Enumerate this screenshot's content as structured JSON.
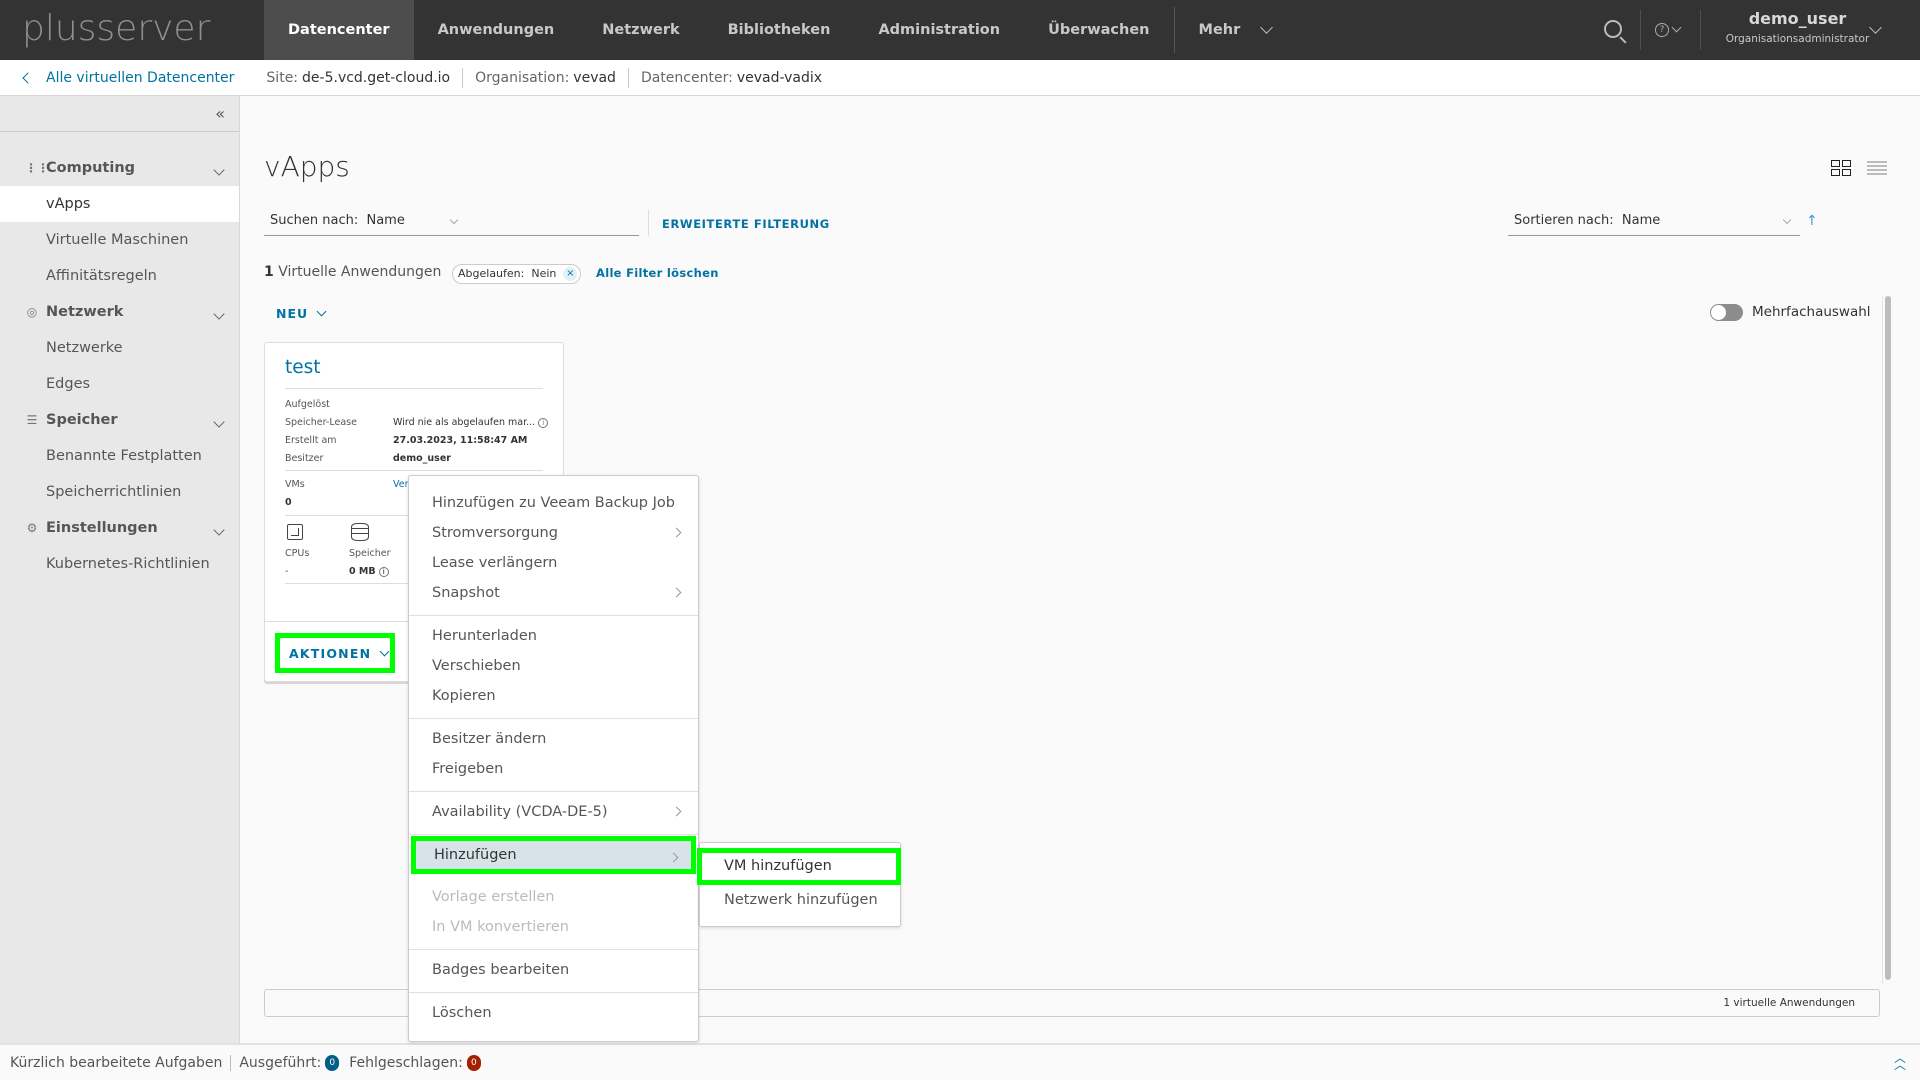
{
  "header": {
    "logo": "plusserver",
    "nav": [
      {
        "label": "Datencenter",
        "active": true
      },
      {
        "label": "Anwendungen"
      },
      {
        "label": "Netzwerk"
      },
      {
        "label": "Bibliotheken"
      },
      {
        "label": "Administration"
      },
      {
        "label": "Überwachen"
      }
    ],
    "more_label": "Mehr",
    "help_icon": "?",
    "user_name": "demo_user",
    "user_role": "Organisationsadministrator"
  },
  "breadcrumb": {
    "back_label": "Alle virtuellen Datencenter",
    "site_label": "Site:",
    "site_value": "de-5.vcd.get-cloud.io",
    "org_label": "Organisation:",
    "org_value": "vevad",
    "dc_label": "Datencenter:",
    "dc_value": "vevad-vadix"
  },
  "sidebar": {
    "collapse_icon": "«",
    "groups": [
      {
        "label": "Computing",
        "icon": "⋮⋮",
        "items": [
          "vApps",
          "Virtuelle Maschinen",
          "Affinitätsregeln"
        ]
      },
      {
        "label": "Netzwerk",
        "icon": "◎",
        "items": [
          "Netzwerke",
          "Edges"
        ]
      },
      {
        "label": "Speicher",
        "icon": "☰",
        "items": [
          "Benannte Festplatten",
          "Speicherrichtlinien"
        ]
      },
      {
        "label": "Einstellungen",
        "icon": "⚙",
        "items": [
          "Kubernetes-Richtlinien"
        ]
      }
    ],
    "active_item": "vApps"
  },
  "main": {
    "title": "vApps",
    "search_label": "Suchen nach:  Name",
    "advanced_filter": "ERWEITERTE FILTERUNG",
    "sort_label": "Sortieren nach:  Name",
    "sort_arrow": "↑",
    "count_number": "1",
    "count_label": " Virtuelle Anwendungen",
    "filter_chip": "Abgelaufen:  Nein",
    "filter_chip_remove": "×",
    "clear_filters": "Alle Filter löschen",
    "new_button": "NEU",
    "multiselect_label": "Mehrfachauswahl",
    "multiselect_on": false,
    "footer_count": "1 virtuelle Anwendungen"
  },
  "card": {
    "title": "test",
    "status": "Aufgelöst",
    "lease_label": "Speicher-Lease",
    "lease_value": "Wird nie als abgelaufen mar...",
    "created_label": "Erstellt am",
    "created_value": "27.03.2023, 11:58:47 AM",
    "owner_label": "Besitzer",
    "owner_value": "demo_user",
    "vms_label": "VMs",
    "vms_value": "0",
    "vms_link": "Ver",
    "cpu_label": "CPUs",
    "cpu_value": "-",
    "storage_label": "Speicher",
    "storage_value": "0 MB",
    "actions_button": "AKTIONEN"
  },
  "menu": {
    "items": [
      {
        "label": "Hinzufügen zu Veeam Backup Job"
      },
      {
        "label": "Stromversorgung",
        "submenu": true
      },
      {
        "label": "Lease verlängern"
      },
      {
        "label": "Snapshot",
        "submenu": true
      },
      {
        "label": "Herunterladen"
      },
      {
        "label": "Verschieben"
      },
      {
        "label": "Kopieren"
      },
      {
        "label": "Besitzer ändern"
      },
      {
        "label": "Freigeben"
      },
      {
        "label": "Availability (VCDA-DE-5)",
        "submenu": true
      },
      {
        "label": "Hinzufügen",
        "submenu": true,
        "highlighted": true
      },
      {
        "label": "Vorlage erstellen",
        "disabled": true
      },
      {
        "label": "In VM konvertieren",
        "disabled": true
      },
      {
        "label": "Badges bearbeiten"
      },
      {
        "label": "Löschen"
      }
    ],
    "submenu_items": [
      {
        "label": "VM hinzufügen",
        "highlighted": true
      },
      {
        "label": "Netzwerk hinzufügen"
      }
    ]
  },
  "statusbar": {
    "tasks_label": "Kürzlich bearbeitete Aufgaben",
    "done_label": "Ausgeführt:",
    "done_count": "0",
    "failed_label": "Fehlgeschlagen:",
    "failed_count": "0",
    "colors": {
      "done": "#005f87",
      "failed": "#a32100"
    }
  }
}
